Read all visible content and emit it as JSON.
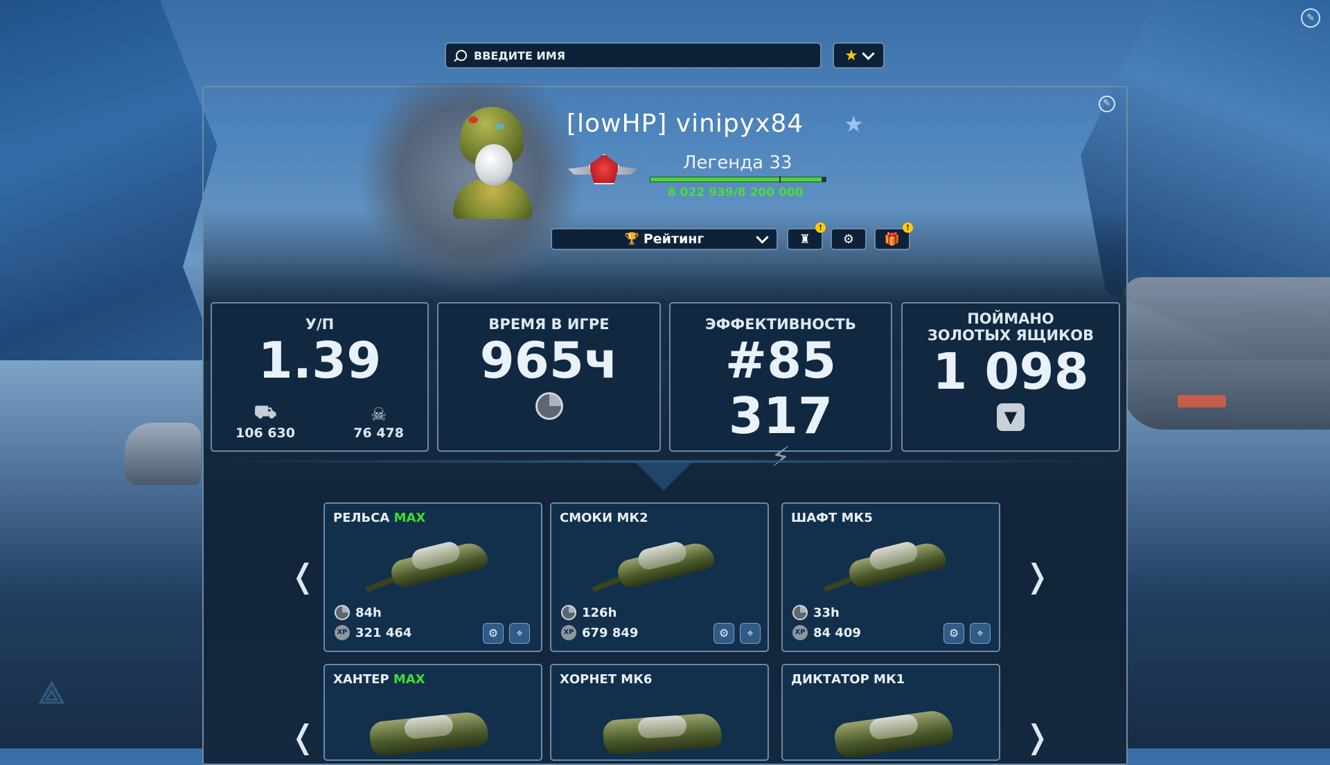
{
  "search": {
    "placeholder": "ВВЕДИТЕ ИМЯ"
  },
  "profile": {
    "nickname": "[lowHP] vinipyx84",
    "rank_name": "Легенда 33",
    "experience": "8 022 939/8 200 000",
    "experience_progress": 0.978
  },
  "tab_select": {
    "label": "Рейтинг"
  },
  "stats": [
    {
      "label": "У/П",
      "value": "1.39",
      "kills": "106 630",
      "deaths": "76 478"
    },
    {
      "label": "ВРЕМЯ В ИГРЕ",
      "value": "965ч"
    },
    {
      "label": "ЭФФЕКТИВНОСТЬ",
      "value": "#85 317"
    },
    {
      "label_line1": "ПОЙМАНО",
      "label_line2": "ЗОЛОТЫХ ЯЩИКОВ",
      "value": "1 098"
    }
  ],
  "turrets": [
    {
      "name": "РЕЛЬСА",
      "grade": "MAX",
      "hours": "84h",
      "xp": "321 464"
    },
    {
      "name": "СМОКИ МК2",
      "grade": "",
      "hours": "126h",
      "xp": "679 849"
    },
    {
      "name": "ШАФТ МК5",
      "grade": "",
      "hours": "33h",
      "xp": "84 409"
    }
  ],
  "hulls": [
    {
      "name": "ХАНТЕР",
      "grade": "MAX"
    },
    {
      "name": "ХОРНЕТ МК6",
      "grade": ""
    },
    {
      "name": "ДИКТАТОР МК1",
      "grade": ""
    }
  ],
  "icons": {
    "search": "search-icon",
    "favorite": "star-icon",
    "trophy": "trophy-icon",
    "clan": "clan-icon",
    "settings": "gear-icon",
    "gift": "gift-icon",
    "edit": "edit-icon"
  },
  "colors": {
    "accent_green": "#3ee02e",
    "alert_yellow": "#ffcc00",
    "star_gold": "#ffc800"
  }
}
